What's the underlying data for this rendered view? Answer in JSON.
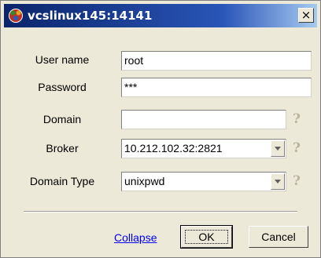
{
  "window": {
    "title": "vcslinux145:14141",
    "close_glyph": "×"
  },
  "form": {
    "user_name": {
      "label": "User name",
      "value": "root"
    },
    "password": {
      "label": "Password",
      "value": "***"
    },
    "domain": {
      "label": "Domain",
      "value": ""
    },
    "broker": {
      "label": "Broker",
      "value": "10.212.102.32:2821"
    },
    "domain_type": {
      "label": "Domain Type",
      "value": "unixpwd"
    },
    "help_glyph": "?"
  },
  "actions": {
    "collapse_label": "Collapse",
    "ok_label": "OK",
    "cancel_label": "Cancel"
  },
  "icons": {
    "app_icon": "app-logo-icon",
    "help_icon": "help-question-icon",
    "dropdown_icon": "chevron-down-icon",
    "close_icon": "close-icon"
  },
  "colors": {
    "titlebar_start": "#0a246a",
    "titlebar_end": "#a6caf0",
    "link": "#0000ee",
    "help_icon": "#b8b49a"
  }
}
